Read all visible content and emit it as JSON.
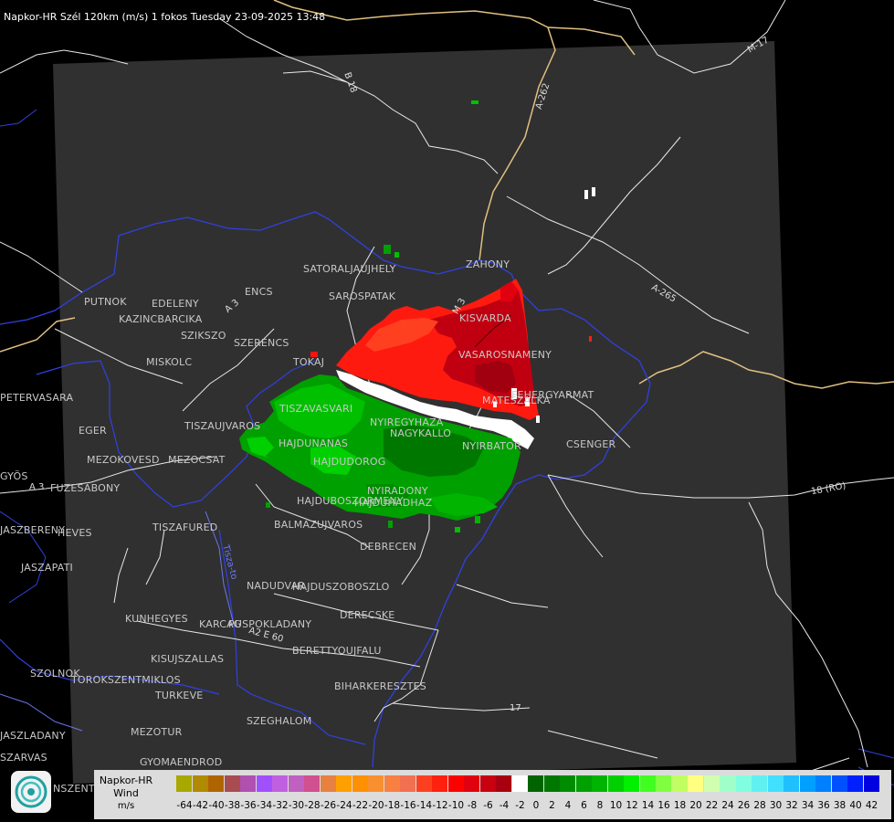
{
  "title": "Napkor-HR Szél 120km (m/s) 1 fokos Tuesday 23-09-2025 13:48",
  "cities": [
    {
      "id": "satoraljaujhely",
      "name": "SATORALJAUJHELY"
    },
    {
      "id": "zahony",
      "name": "ZAHONY"
    },
    {
      "id": "sarospatak",
      "name": "SAROSPATAK"
    },
    {
      "id": "putnok",
      "name": "PUTNOK"
    },
    {
      "id": "edeleny",
      "name": "EDELENY"
    },
    {
      "id": "kazincbarcika",
      "name": "KAZINCBARCIKA"
    },
    {
      "id": "encs",
      "name": "ENCS"
    },
    {
      "id": "szikszo",
      "name": "SZIKSZO"
    },
    {
      "id": "szerencs",
      "name": "SZERENCS"
    },
    {
      "id": "kisvarda",
      "name": "KISVARDA"
    },
    {
      "id": "miskolc",
      "name": "MISKOLC"
    },
    {
      "id": "tokaj",
      "name": "TOKAJ"
    },
    {
      "id": "vasarosnameny",
      "name": "VASAROSNAMENY"
    },
    {
      "id": "matesz",
      "name": "MATESZALKA"
    },
    {
      "id": "feheregyarmat",
      "name": "FEHERGYARMAT"
    },
    {
      "id": "petervasara",
      "name": "PETERVASARA"
    },
    {
      "id": "tiszavasvari",
      "name": "TISZAVASVARI"
    },
    {
      "id": "nyiregyhaza",
      "name": "NYIREGYHAZA"
    },
    {
      "id": "nagykallo",
      "name": "NAGYKALLO"
    },
    {
      "id": "eger",
      "name": "EGER"
    },
    {
      "id": "tiszaujvaros",
      "name": "TISZAUJVAROS"
    },
    {
      "id": "nyirbator",
      "name": "NYIRBATOR"
    },
    {
      "id": "csenger",
      "name": "CSENGER"
    },
    {
      "id": "hajdunanas",
      "name": "HAJDUNANAS"
    },
    {
      "id": "mezokovesd",
      "name": "MEZOKOVESD"
    },
    {
      "id": "mezocsat",
      "name": "MEZOCSAT"
    },
    {
      "id": "hajdudorog",
      "name": "HAJDUDOROG"
    },
    {
      "id": "gyongyos",
      "name": "GYÖS"
    },
    {
      "id": "fuzesabony",
      "name": "FUZESABONY"
    },
    {
      "id": "nyiradony",
      "name": "NYIRADONY"
    },
    {
      "id": "hajduboszormeny",
      "name": "HAJDUBOSZORMENY"
    },
    {
      "id": "hajduhadhaz",
      "name": "HAJDUHADHAZ"
    },
    {
      "id": "heves",
      "name": "HEVES"
    },
    {
      "id": "tiszafured",
      "name": "TISZAFURED"
    },
    {
      "id": "balmazujvaros",
      "name": "BALMAZUJVAROS"
    },
    {
      "id": "jaszapati",
      "name": "JASZAPATI"
    },
    {
      "id": "debrecen",
      "name": "DEBRECEN"
    },
    {
      "id": "jaszbereny",
      "name": "JASZBERENY"
    },
    {
      "id": "nadudvar",
      "name": "NADUDVAR"
    },
    {
      "id": "hajduszoboszlo",
      "name": "HAJDUSZOBOSZLO"
    },
    {
      "id": "derecske",
      "name": "DERECSKE"
    },
    {
      "id": "kunhegyes",
      "name": "KUNHEGYES"
    },
    {
      "id": "karcag",
      "name": "KARCAG"
    },
    {
      "id": "puspokladany",
      "name": "PUSPOKLADANY"
    },
    {
      "id": "kisujszallas",
      "name": "KISUJSZALLAS"
    },
    {
      "id": "berettyoujfalu",
      "name": "BERETTYOUJFALU"
    },
    {
      "id": "szolnok",
      "name": "SZOLNOK"
    },
    {
      "id": "torokszentmiklos",
      "name": "TOROKSZENTMIKLOS"
    },
    {
      "id": "biharkeresztes",
      "name": "BIHARKERESZTES"
    },
    {
      "id": "turkeve",
      "name": "TURKEVE"
    },
    {
      "id": "szeghalom",
      "name": "SZEGHALOM"
    },
    {
      "id": "mezotur",
      "name": "MEZOTUR"
    },
    {
      "id": "kunszentmarton",
      "name": "NSZENTMARTON"
    },
    {
      "id": "gyomaendrod",
      "name": "GYOMAENDROD"
    },
    {
      "id": "szarvas",
      "name": "SZARVAS"
    },
    {
      "id": "jaszladany",
      "name": "JASZLADANY"
    }
  ],
  "roads": [
    {
      "id": "b18",
      "name": "B 18"
    },
    {
      "id": "a262",
      "name": "A-262"
    },
    {
      "id": "m17",
      "name": "M-17"
    },
    {
      "id": "a265",
      "name": "A-265"
    },
    {
      "id": "a3",
      "name": "A 3"
    },
    {
      "id": "m3",
      "name": "M 3"
    },
    {
      "id": "a3b",
      "name": "A 3"
    },
    {
      "id": "e60",
      "name": "A2 E 60"
    },
    {
      "id": "r18",
      "name": "18 (RO)"
    },
    {
      "id": "r17",
      "name": "17"
    },
    {
      "id": "tisza",
      "name": "Tisza-to"
    }
  ],
  "legend": {
    "title_line1": "Napkor-HR",
    "title_line2": "Wind",
    "unit": "m/s",
    "scale": [
      {
        "value": "-64",
        "color": "#a8a800"
      },
      {
        "value": "-42",
        "color": "#b08a00"
      },
      {
        "value": "-40",
        "color": "#b06400"
      },
      {
        "value": "-38",
        "color": "#a84c50"
      },
      {
        "value": "-36",
        "color": "#b050b0"
      },
      {
        "value": "-34",
        "color": "#a050ff"
      },
      {
        "value": "-32",
        "color": "#c060e0"
      },
      {
        "value": "-30",
        "color": "#c060c0"
      },
      {
        "value": "-28",
        "color": "#d05090"
      },
      {
        "value": "-26",
        "color": "#e88040"
      },
      {
        "value": "-24",
        "color": "#ffa000"
      },
      {
        "value": "-22",
        "color": "#ff9000"
      },
      {
        "value": "-20",
        "color": "#f89030"
      },
      {
        "value": "-18",
        "color": "#f88040"
      },
      {
        "value": "-16",
        "color": "#f07050"
      },
      {
        "value": "-14",
        "color": "#ff4020"
      },
      {
        "value": "-12",
        "color": "#ff2010"
      },
      {
        "value": "-10",
        "color": "#ff0000"
      },
      {
        "value": "-8",
        "color": "#e00010"
      },
      {
        "value": "-6",
        "color": "#c80010"
      },
      {
        "value": "-4",
        "color": "#a80010"
      },
      {
        "value": "-2",
        "color": "#ffffff"
      },
      {
        "value": "0",
        "color": "#006400"
      },
      {
        "value": "2",
        "color": "#007800"
      },
      {
        "value": "4",
        "color": "#008c00"
      },
      {
        "value": "6",
        "color": "#00a000"
      },
      {
        "value": "8",
        "color": "#00b400"
      },
      {
        "value": "10",
        "color": "#00d000"
      },
      {
        "value": "12",
        "color": "#00f000"
      },
      {
        "value": "14",
        "color": "#40ff20"
      },
      {
        "value": "16",
        "color": "#80ff40"
      },
      {
        "value": "18",
        "color": "#c0ff60"
      },
      {
        "value": "20",
        "color": "#ffff80"
      },
      {
        "value": "22",
        "color": "#d0ffb0"
      },
      {
        "value": "24",
        "color": "#a0ffc8"
      },
      {
        "value": "26",
        "color": "#80ffe0"
      },
      {
        "value": "28",
        "color": "#60f0f0"
      },
      {
        "value": "30",
        "color": "#40e0ff"
      },
      {
        "value": "32",
        "color": "#20c0ff"
      },
      {
        "value": "34",
        "color": "#00a0ff"
      },
      {
        "value": "36",
        "color": "#0080ff"
      },
      {
        "value": "38",
        "color": "#0050ff"
      },
      {
        "value": "40",
        "color": "#0020ff"
      },
      {
        "value": "42",
        "color": "#0000e0"
      }
    ]
  }
}
